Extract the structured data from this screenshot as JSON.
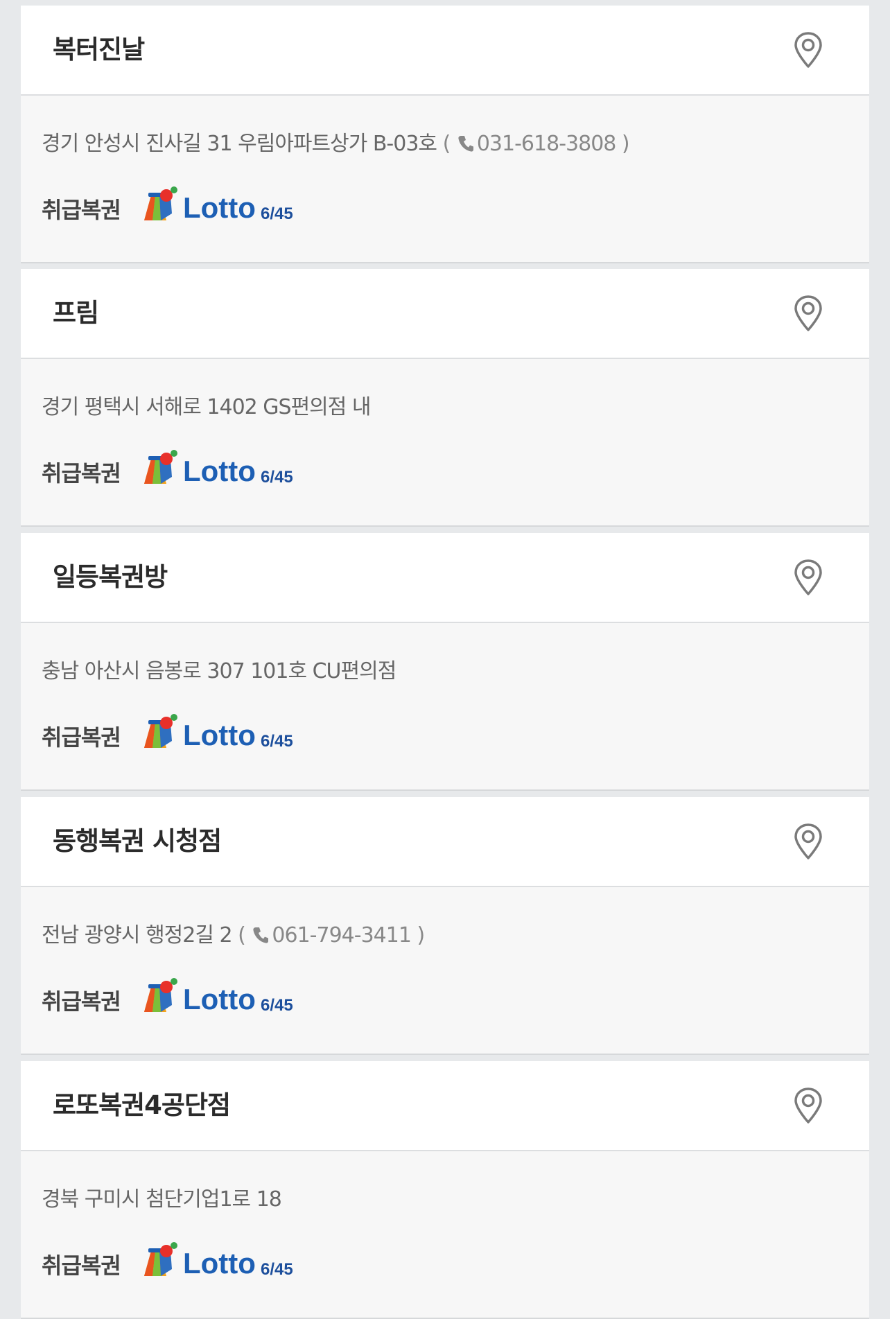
{
  "stores": [
    {
      "name": "복터진날",
      "address": "경기 안성시 진사길 31 우림아파트상가 B-03호",
      "phone": "031-618-3808",
      "games_label": "취급복권",
      "game": "Lotto",
      "game_sub": "6/45",
      "icon": "map-pin-icon"
    },
    {
      "name": "프림",
      "address": "경기 평택시 서해로 1402 GS편의점 내",
      "phone": "",
      "games_label": "취급복권",
      "game": "Lotto",
      "game_sub": "6/45",
      "icon": "map-pin-icon"
    },
    {
      "name": "일등복권방",
      "address": "충남 아산시 음봉로 307 101호 CU편의점",
      "phone": "",
      "games_label": "취급복권",
      "game": "Lotto",
      "game_sub": "6/45",
      "icon": "map-pin-icon"
    },
    {
      "name": "동행복권 시청점",
      "address": "전남 광양시 행정2길 2",
      "phone": "061-794-3411",
      "games_label": "취급복권",
      "game": "Lotto",
      "game_sub": "6/45",
      "icon": "map-pin-icon"
    },
    {
      "name": "로또복권4공단점",
      "address": "경북 구미시 첨단기업1로 18",
      "phone": "",
      "games_label": "취급복권",
      "game": "Lotto",
      "game_sub": "6/45",
      "icon": "map-pin-icon"
    }
  ],
  "colors": {
    "lotto_blue": "#1d5fb4",
    "lotto_green": "#8cc63f",
    "sub_blue": "#1d4f9c",
    "pin_stroke": "#7a7a7a"
  }
}
